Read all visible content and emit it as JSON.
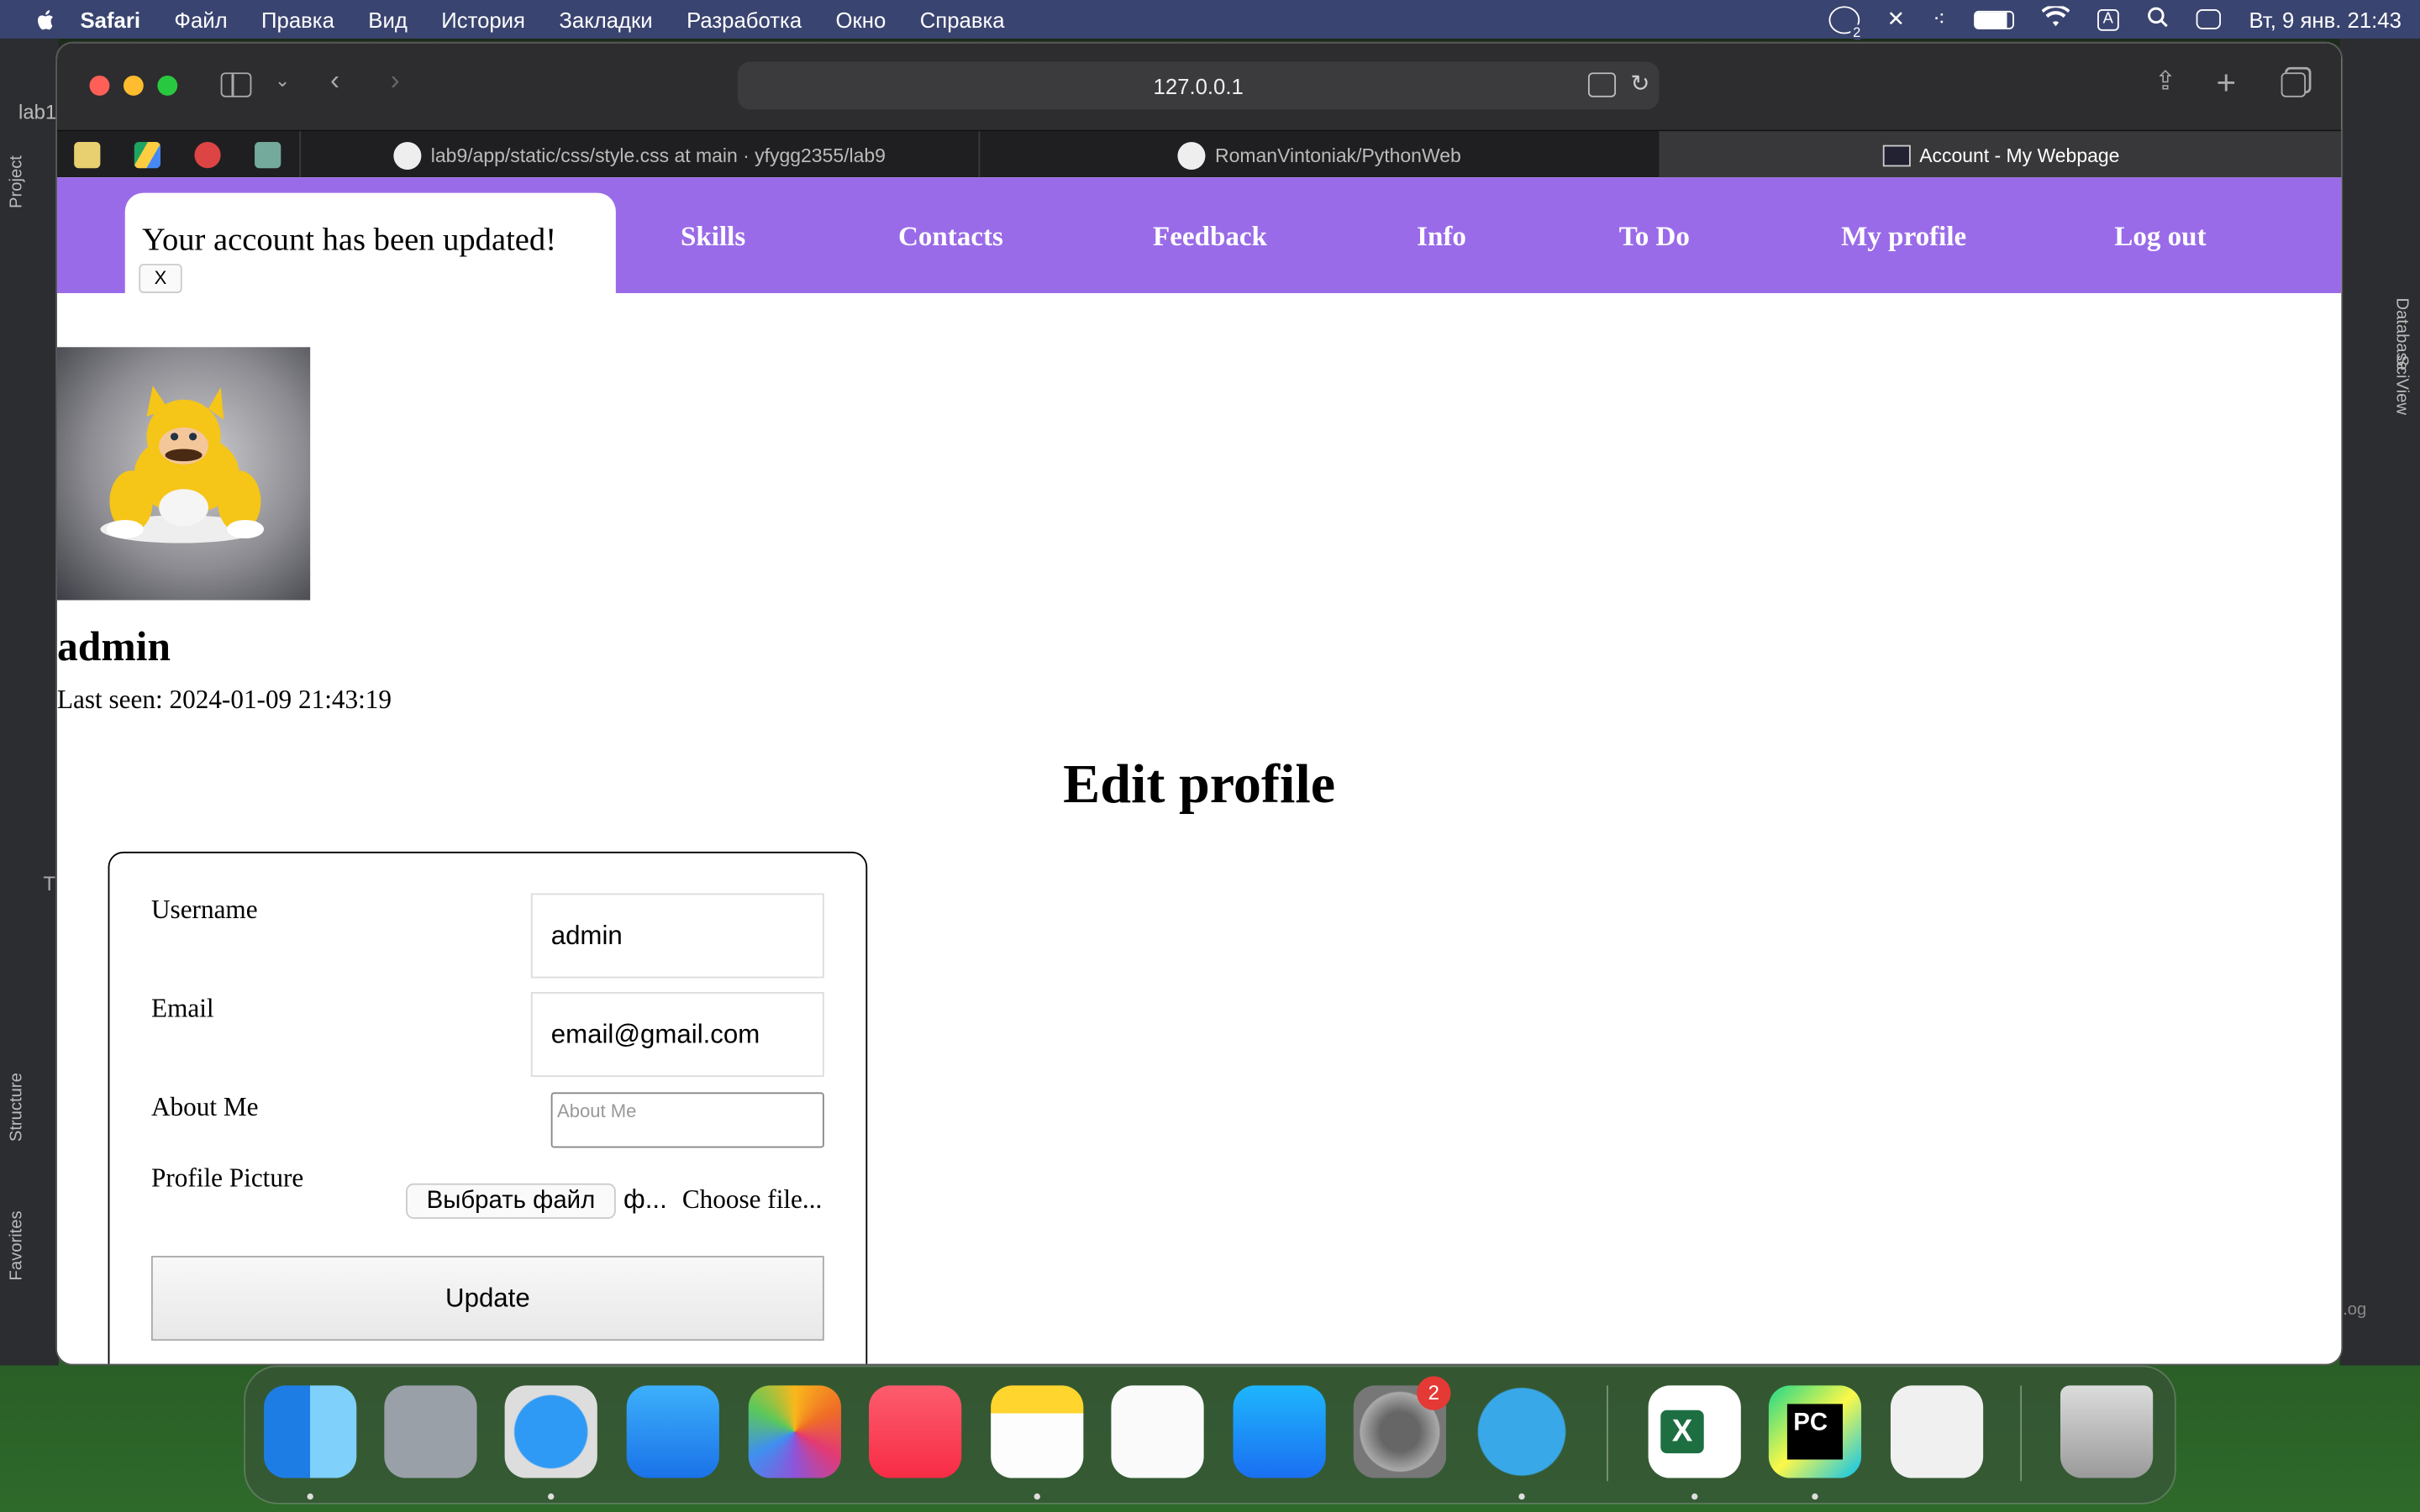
{
  "menubar": {
    "apple": "",
    "app": "Safari",
    "items": [
      "Файл",
      "Правка",
      "Вид",
      "История",
      "Закладки",
      "Разработка",
      "Окно",
      "Справка"
    ],
    "input_indicator": "A",
    "datetime": "Вт, 9 янв.  21:43",
    "notification_badge": "2"
  },
  "ide": {
    "project_label": "Project",
    "structure_label": "Structure",
    "favorites_label": "Favorites",
    "database_label": "Database",
    "sciview_label": "SciView",
    "file_tab": "lab1",
    "log_label": ".og",
    "t_label": "T"
  },
  "browser": {
    "address": "127.0.0.1",
    "tabs": [
      {
        "title": "lab9/app/static/css/style.css at main · yfygg2355/lab9"
      },
      {
        "title": "RomanVintoniak/PythonWeb"
      },
      {
        "title": "Account - My Webpage"
      }
    ]
  },
  "nav": {
    "links": [
      "Skills",
      "Contacts",
      "Feedback",
      "Info",
      "To Do",
      "My profile",
      "Log out"
    ]
  },
  "flash": {
    "message": "Your account has been updated!",
    "close": "X"
  },
  "profile": {
    "username": "admin",
    "last_seen": "Last seen: 2024-01-09 21:43:19"
  },
  "form": {
    "heading": "Edit profile",
    "username_label": "Username",
    "username_value": "admin",
    "email_label": "Email",
    "email_value": "email@gmail.com",
    "about_label": "About Me",
    "about_placeholder": "About Me",
    "picture_label": "Profile Picture",
    "choose_button": "Выбрать файл",
    "file_name": "ф...",
    "choose_text": "Choose file...",
    "submit": "Update"
  },
  "dock": {
    "apps": [
      "Finder",
      "Launchpad",
      "Safari",
      "Mail",
      "Photos",
      "Music",
      "Notes",
      "Freeform",
      "App Store",
      "System Settings",
      "Telegram",
      "Excel",
      "PyCharm",
      "System Information",
      "Trash"
    ],
    "settings_badge": "2",
    "pycharm_label": "PC",
    "excel_label": "X"
  },
  "colors": {
    "nav_bg": "#9a6be8",
    "menubar_bg": "#3a4470"
  }
}
